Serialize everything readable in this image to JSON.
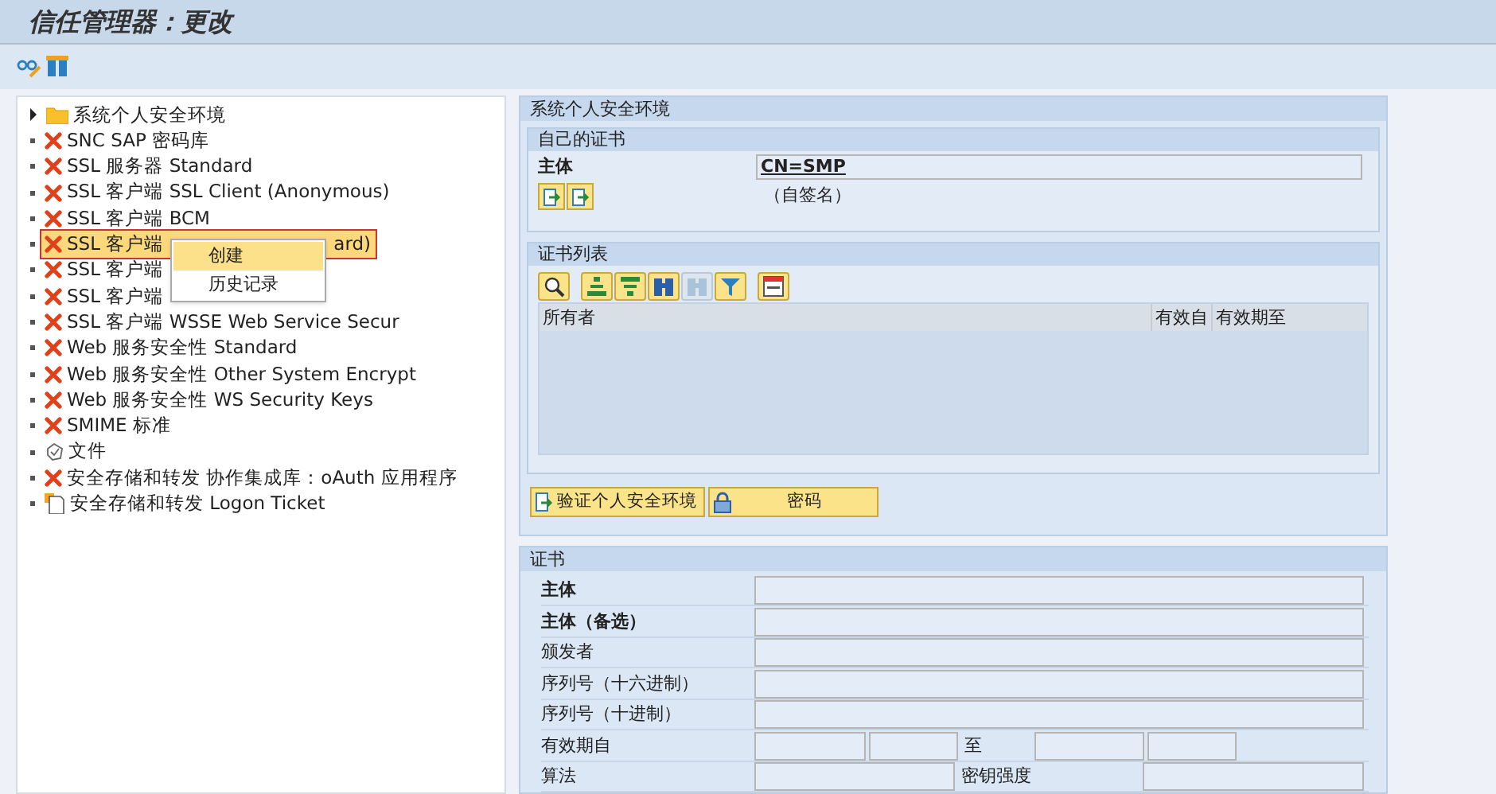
{
  "window": {
    "title": "信任管理器：更改"
  },
  "tree": {
    "items": [
      {
        "kind": "folder",
        "label": "系统个人安全环境",
        "expandable": true,
        "selected": false
      },
      {
        "kind": "error",
        "label": "SNC SAP 密码库",
        "expandable": false,
        "selected": false
      },
      {
        "kind": "error",
        "label": "SSL 服务器 Standard",
        "expandable": false,
        "selected": false
      },
      {
        "kind": "error",
        "label": "SSL 客户端 SSL Client (Anonymous)",
        "expandable": false,
        "selected": false
      },
      {
        "kind": "error",
        "label": "SSL 客户端 BCM",
        "expandable": false,
        "selected": false
      },
      {
        "kind": "error",
        "label": "SSL 客户端",
        "tail": "ard)",
        "expandable": false,
        "selected": true
      },
      {
        "kind": "error",
        "label": "SSL 客户端",
        "expandable": false,
        "selected": false
      },
      {
        "kind": "error",
        "label": "SSL 客户端",
        "expandable": false,
        "selected": false
      },
      {
        "kind": "error",
        "label": "SSL 客户端 WSSE Web Service Secur",
        "expandable": false,
        "selected": false
      },
      {
        "kind": "error",
        "label": "Web 服务安全性 Standard",
        "expandable": false,
        "selected": false
      },
      {
        "kind": "error",
        "label": "Web 服务安全性 Other System Encrypt",
        "expandable": false,
        "selected": false
      },
      {
        "kind": "error",
        "label": "Web 服务安全性 WS Security Keys",
        "expandable": false,
        "selected": false
      },
      {
        "kind": "error",
        "label": "SMIME 标准",
        "expandable": false,
        "selected": false
      },
      {
        "kind": "file",
        "label": "文件",
        "expandable": false,
        "selected": false
      },
      {
        "kind": "error",
        "label": "安全存储和转发 协作集成库：oAuth 应用程序",
        "expandable": false,
        "selected": false
      },
      {
        "kind": "ticket",
        "label": "安全存储和转发 Logon Ticket",
        "expandable": false,
        "selected": false
      }
    ]
  },
  "context_menu": {
    "items": [
      {
        "label": "创建",
        "selected": true
      },
      {
        "label": "历史记录",
        "selected": false
      }
    ]
  },
  "pse": {
    "title": "系统个人安全环境",
    "own_cert": {
      "title": "自己的证书",
      "subject_label": "主体",
      "subject_value": "CN=SMP",
      "note": "（自签名）"
    },
    "cert_list": {
      "title": "证书列表",
      "toolbar": [
        {
          "kind": "details",
          "disabled": false
        },
        {
          "kind": "sort-up",
          "disabled": false
        },
        {
          "kind": "sort-down",
          "disabled": false
        },
        {
          "kind": "find",
          "disabled": false
        },
        {
          "kind": "find-next",
          "disabled": true
        },
        {
          "kind": "filter",
          "disabled": false
        },
        {
          "kind": "layout",
          "disabled": false
        }
      ],
      "columns": [
        "所有者",
        "有效自",
        "有效期至"
      ]
    },
    "buttons": [
      {
        "kind": "verify",
        "label": "验证个人安全环境"
      },
      {
        "kind": "lock",
        "label": "密码"
      }
    ]
  },
  "certificate": {
    "title": "证书",
    "fields": [
      {
        "kind": "single",
        "label": "主体",
        "bold": true
      },
      {
        "kind": "single",
        "label": "主体（备选）",
        "bold": true
      },
      {
        "kind": "single",
        "label": "颁发者",
        "bold": false
      },
      {
        "kind": "single",
        "label": "序列号（十六进制）",
        "bold": false
      },
      {
        "kind": "single",
        "label": "序列号（十进制）",
        "bold": false
      },
      {
        "kind": "range",
        "label": "有效期自",
        "mid_label": "至",
        "bold": false
      },
      {
        "kind": "pair",
        "label": "算法",
        "mid_label": "密钥强度",
        "bold": false
      }
    ]
  }
}
